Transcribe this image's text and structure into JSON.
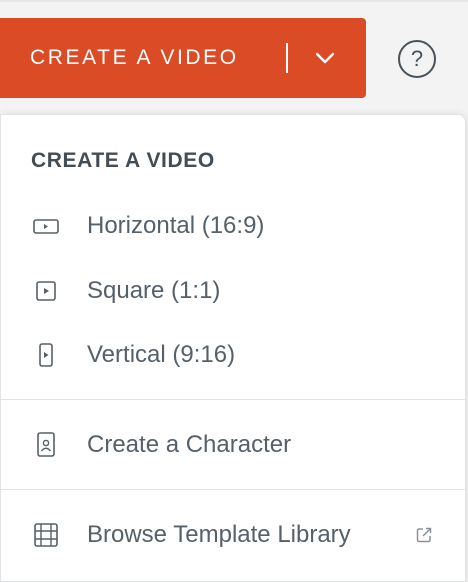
{
  "toolbar": {
    "create_label": "CREATE A VIDEO",
    "caret_icon": "chevron-down-icon",
    "help_label": "?",
    "brand_color": "#db4b25"
  },
  "menu": {
    "heading": "CREATE A VIDEO",
    "video_items": [
      {
        "label": "Horizontal (16:9)",
        "icon": "horizontal-video-icon"
      },
      {
        "label": "Square (1:1)",
        "icon": "square-video-icon"
      },
      {
        "label": "Vertical (9:16)",
        "icon": "vertical-video-icon"
      }
    ],
    "character_item": {
      "label": "Create a Character",
      "icon": "character-card-icon"
    },
    "template_item": {
      "label": "Browse Template Library",
      "icon": "film-grid-icon",
      "external_icon": "external-link-icon"
    }
  }
}
